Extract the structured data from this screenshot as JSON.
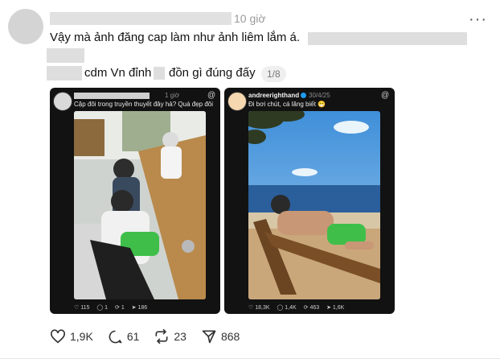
{
  "post": {
    "time": "10 giờ",
    "line1": "Vậy mà ảnh đăng cap làm như ảnh liêm lắm á.",
    "line3_a": "cdm Vn đỉnh",
    "line3_b": "đồn gì đúng đấy",
    "image_counter": "1/8",
    "more_label": "···"
  },
  "card_left": {
    "time": "1 giờ",
    "text": "Cặp đôi trong truyền thuyết đây hả? Quá đẹp đôi",
    "likes": "115",
    "comments": "1",
    "reposts": "1",
    "shares": "186"
  },
  "card_right": {
    "username": "andreerighthand",
    "date": "30/4/25",
    "text": "Đi bơi chút, cá lăng biết 😁",
    "likes": "18,3K",
    "comments": "1,4K",
    "reposts": "463",
    "shares": "1,6K"
  },
  "actions": {
    "likes": "1,9K",
    "comments": "61",
    "reposts": "23",
    "shares": "868"
  },
  "colors": {
    "text": "#111111",
    "muted": "#9a9a9a",
    "card_bg": "#121212",
    "verified": "#1d9bf0",
    "shorts": "#3fbf4a"
  }
}
